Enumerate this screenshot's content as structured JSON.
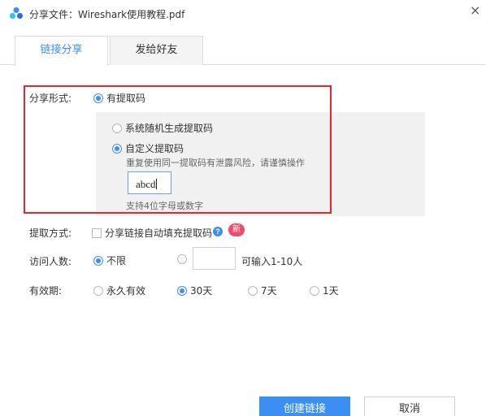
{
  "window": {
    "title": "分享文件：Wireshark使用教程.pdf",
    "close_glyph": "×"
  },
  "tabs": [
    {
      "label": "链接分享",
      "active": true
    },
    {
      "label": "发给好友",
      "active": false
    }
  ],
  "share_form": {
    "label": "分享形式:",
    "option_code": "有提取码",
    "suboption_random": "系统随机生成提取码",
    "suboption_custom": "自定义提取码",
    "warning": "重复使用同一提取码有泄露风险，请谨慎操作",
    "code_value": "abcd",
    "code_hint": "支持4位字母或数字"
  },
  "extract_method": {
    "label": "提取方式:",
    "checkbox_label": "分享链接自动填充提取码",
    "help_glyph": "?",
    "badge": "新"
  },
  "visitors": {
    "label": "访问人数:",
    "option_unlimited": "不限",
    "input_value": "",
    "hint": "可输入1-10人"
  },
  "validity": {
    "label": "有效期:",
    "options": [
      "永久有效",
      "30天",
      "7天",
      "1天"
    ],
    "selected": "30天"
  },
  "buttons": {
    "create": "创建链接",
    "cancel": "取消"
  },
  "colors": {
    "accent": "#3b8ff2",
    "highlight_frame": "#e8262c",
    "badge": "#f2496b",
    "panel": "#f1f1f1"
  }
}
